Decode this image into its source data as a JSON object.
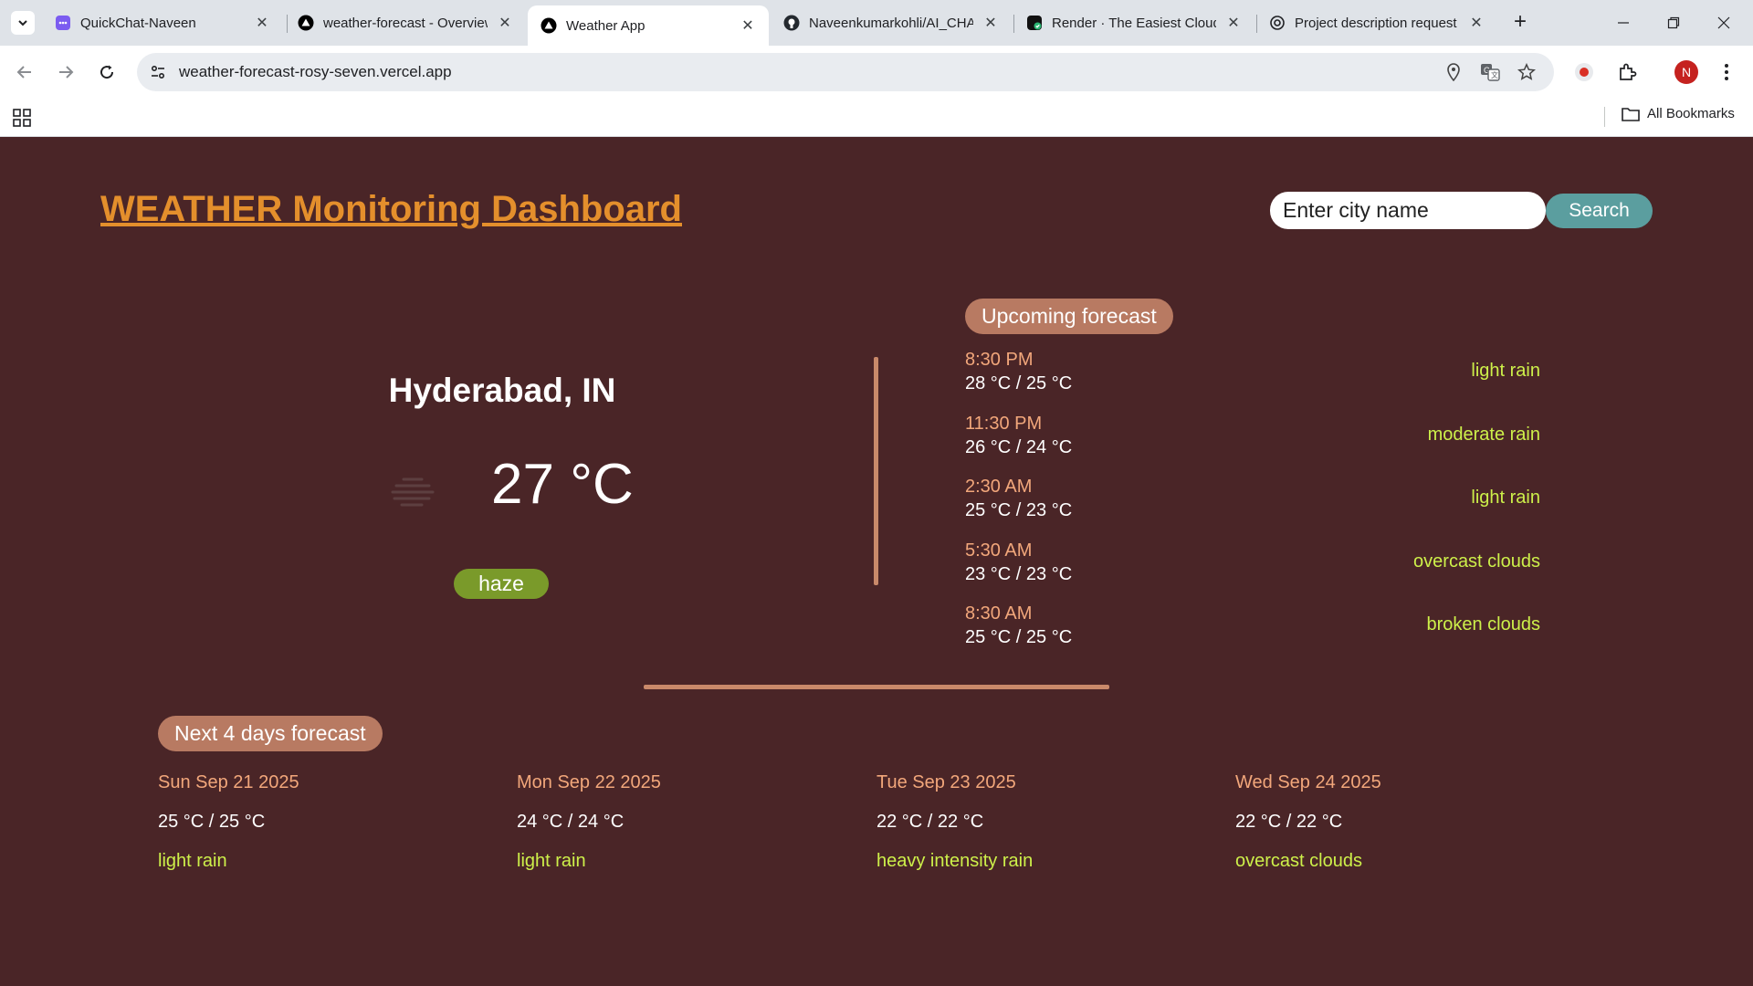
{
  "browser": {
    "tabs": [
      {
        "title": "QuickChat-Naveen",
        "icon": "quickchat-icon"
      },
      {
        "title": "weather-forecast - Overview",
        "icon": "vercel-icon"
      },
      {
        "title": "Weather App",
        "icon": "vercel-icon"
      },
      {
        "title": "Naveenkumarkohli/AI_CHAT",
        "icon": "github-icon"
      },
      {
        "title": "Render · The Easiest Cloud",
        "icon": "render-icon"
      },
      {
        "title": "Project description request",
        "icon": "openai-icon"
      }
    ],
    "active_tab_index": 2,
    "url": "weather-forecast-rosy-seven.vercel.app",
    "profile_initial": "N",
    "bookmarks_label": "All Bookmarks"
  },
  "dashboard": {
    "title": "WEATHER Monitoring Dashboard",
    "search": {
      "placeholder": "Enter city name",
      "button_label": "Search"
    }
  },
  "current": {
    "city": "Hyderabad, IN",
    "temperature": "27 °C",
    "condition": "haze",
    "icon": "haze-icon"
  },
  "upcoming": {
    "heading": "Upcoming forecast",
    "items": [
      {
        "time": "8:30 PM",
        "temps": "28 °C / 25 °C",
        "desc": "light rain"
      },
      {
        "time": "11:30 PM",
        "temps": "26 °C / 24 °C",
        "desc": "moderate rain"
      },
      {
        "time": "2:30 AM",
        "temps": "25 °C / 23 °C",
        "desc": "light rain"
      },
      {
        "time": "5:30 AM",
        "temps": "23 °C / 23 °C",
        "desc": "overcast clouds"
      },
      {
        "time": "8:30 AM",
        "temps": "25 °C / 25 °C",
        "desc": "broken clouds"
      }
    ]
  },
  "next_days": {
    "heading": "Next 4 days forecast",
    "days": [
      {
        "date": "Sun Sep 21 2025",
        "temps": "25 °C / 25 °C",
        "desc": "light rain"
      },
      {
        "date": "Mon Sep 22 2025",
        "temps": "24 °C / 24 °C",
        "desc": "light rain"
      },
      {
        "date": "Tue Sep 23 2025",
        "temps": "22 °C / 22 °C",
        "desc": "heavy intensity rain"
      },
      {
        "date": "Wed Sep 24 2025",
        "temps": "22 °C / 22 °C",
        "desc": "overcast clouds"
      }
    ]
  },
  "colors": {
    "background": "#4a2527",
    "title": "#e48f2c",
    "accent_pill": "#b87a62",
    "divider": "#c9896a",
    "time_text": "#f2a77b",
    "desc_text": "#cdf04a",
    "condition_badge": "#7a9a2a",
    "search_button": "#5b9e9f"
  }
}
